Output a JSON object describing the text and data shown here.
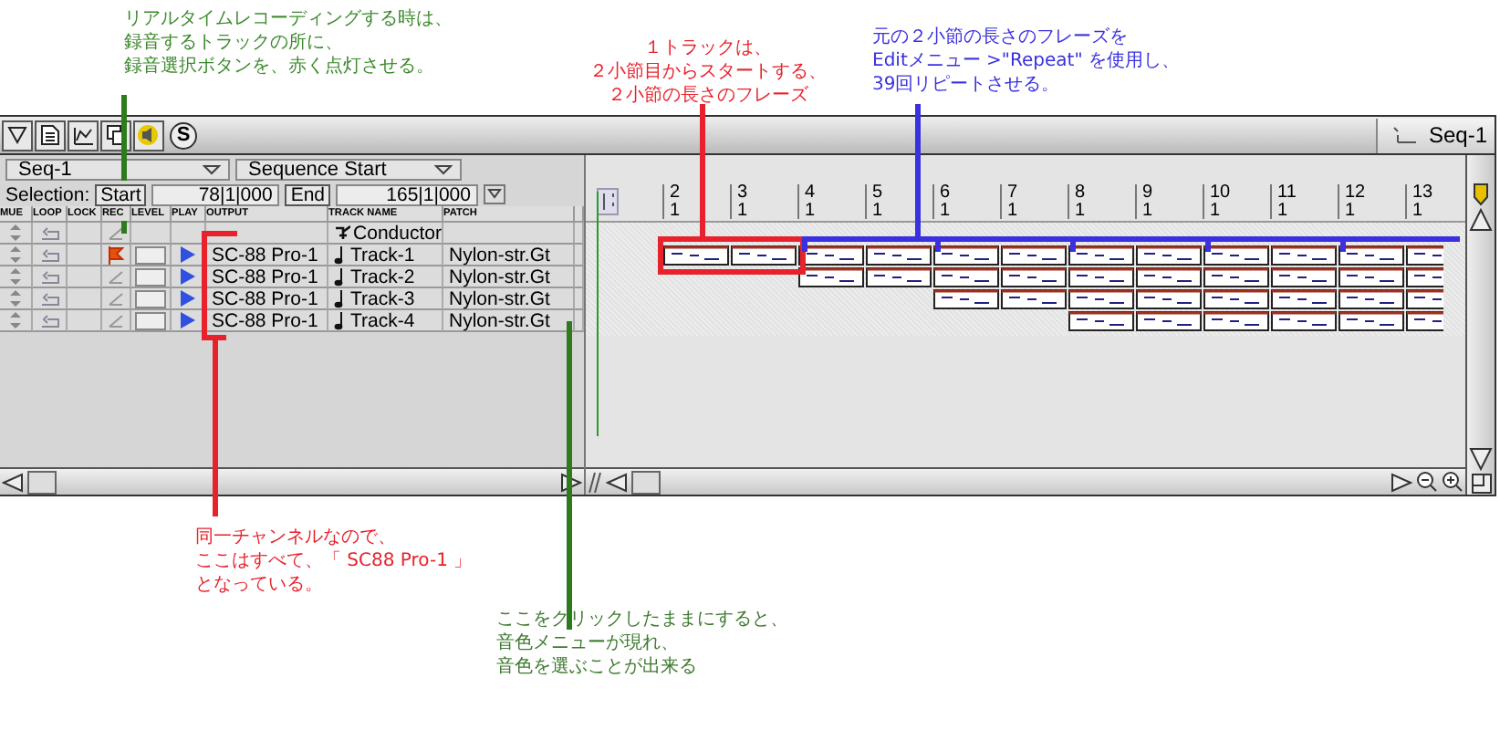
{
  "annotations_top": [
    {
      "lines": [
        "リアルタイムレコーディングする時は、",
        "録音するトラックの所に、",
        "録音選択ボタンを、赤く点灯させる。"
      ],
      "color": "#3d8a2e"
    },
    {
      "lines": [
        "１トラックは、",
        "２小節目からスタートする、",
        "２小節の長さのフレーズ"
      ],
      "color": "#e8222c"
    },
    {
      "lines": [
        "元の２小節の長さのフレーズを",
        "Editメニュー >\"Repeat\" を使用し、",
        "39回リピートさせる。"
      ],
      "color": "#3a30e0"
    }
  ],
  "toolbar": {
    "solo_button": "S",
    "window_tab": "Seq-1"
  },
  "sequence_menu": {
    "value": "Seq-1"
  },
  "start_menu": {
    "value": "Sequence Start"
  },
  "selection": {
    "label": "Selection:",
    "start_button": "Start",
    "start_value": "78|1|000",
    "end_button": "End",
    "end_value": "165|1|000"
  },
  "track_table": {
    "columns": [
      "MUE",
      "LOOP",
      "LOCK",
      "REC",
      "LEVEL",
      "PLAY",
      "OUTPUT",
      "TRACK NAME",
      "PATCH"
    ],
    "rows": [
      {
        "kind": "conductor",
        "name": "Conductor"
      },
      {
        "kind": "track",
        "rec_armed": true,
        "output": "SC-88 Pro-1",
        "name": "Track-1",
        "patch": "Nylon-str.Gt"
      },
      {
        "kind": "track",
        "rec_armed": false,
        "output": "SC-88 Pro-1",
        "name": "Track-2",
        "patch": "Nylon-str.Gt"
      },
      {
        "kind": "track",
        "rec_armed": false,
        "output": "SC-88 Pro-1",
        "name": "Track-3",
        "patch": "Nylon-str.Gt"
      },
      {
        "kind": "track",
        "rec_armed": false,
        "output": "SC-88 Pro-1",
        "name": "Track-4",
        "patch": "Nylon-str.Gt"
      }
    ]
  },
  "ruler": {
    "measures": [
      {
        "bar": "2",
        "beat": "1"
      },
      {
        "bar": "3",
        "beat": "1"
      },
      {
        "bar": "4",
        "beat": "1"
      },
      {
        "bar": "5",
        "beat": "1"
      },
      {
        "bar": "6",
        "beat": "1"
      },
      {
        "bar": "7",
        "beat": "1"
      },
      {
        "bar": "8",
        "beat": "1"
      },
      {
        "bar": "9",
        "beat": "1"
      },
      {
        "bar": "10",
        "beat": "1"
      },
      {
        "bar": "11",
        "beat": "1"
      },
      {
        "bar": "12",
        "beat": "1"
      },
      {
        "bar": "13",
        "beat": "1"
      }
    ]
  },
  "annotations_bottom": [
    {
      "lines": [
        "同一チャンネルなので、",
        "ここはすべて、「 SC88 Pro-1 」",
        "となっている。"
      ],
      "color": "#e8222c"
    },
    {
      "lines": [
        "ここをクリックしたままにすると、",
        "音色メニューが現れ、",
        "音色を選ぶことが出来る"
      ],
      "color": "#3d7a2e"
    }
  ]
}
